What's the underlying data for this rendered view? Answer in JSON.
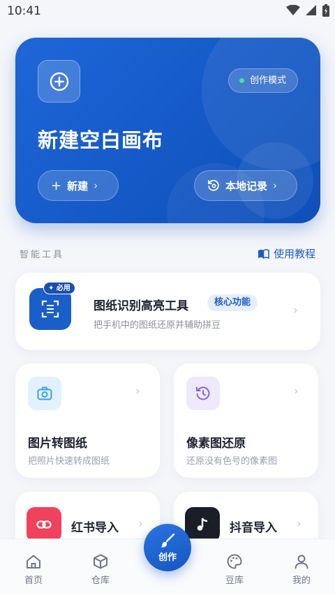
{
  "status_bar": {
    "time": "10:41"
  },
  "hero": {
    "mode_badge": "创作模式",
    "title": "新建空白画布",
    "new_button": "新建",
    "local_button": "本地记录"
  },
  "tools_section": {
    "title": "智能工具",
    "tutorial_link": "使用教程"
  },
  "feature": {
    "badge": "必用",
    "title": "图纸识别高亮工具",
    "core_badge": "核心功能",
    "subtitle": "把手机中的图纸还原并辅助拼豆"
  },
  "tiles": [
    {
      "title": "图片转图纸",
      "subtitle": "把照片快速转成图纸",
      "icon": "camera-icon",
      "icon_bg": "#e3f1fd",
      "icon_color": "#3aa0e8"
    },
    {
      "title": "像素图还原",
      "subtitle": "还原没有色号的像素图",
      "icon": "history-icon",
      "icon_bg": "#efe9fc",
      "icon_color": "#8a64d6"
    }
  ],
  "imports": [
    {
      "title": "红书导入",
      "icon": "link-icon",
      "icon_bg": "#f0415d"
    },
    {
      "title": "抖音导入",
      "icon": "music-note-icon",
      "icon_bg": "#1b1e27"
    }
  ],
  "bottom_nav": {
    "home": "首页",
    "warehouse": "仓库",
    "create": "创作",
    "bean_library": "豆库",
    "mine": "我的"
  },
  "colors": {
    "primary": "#1a5ec9",
    "accent_green": "#4de08a"
  }
}
